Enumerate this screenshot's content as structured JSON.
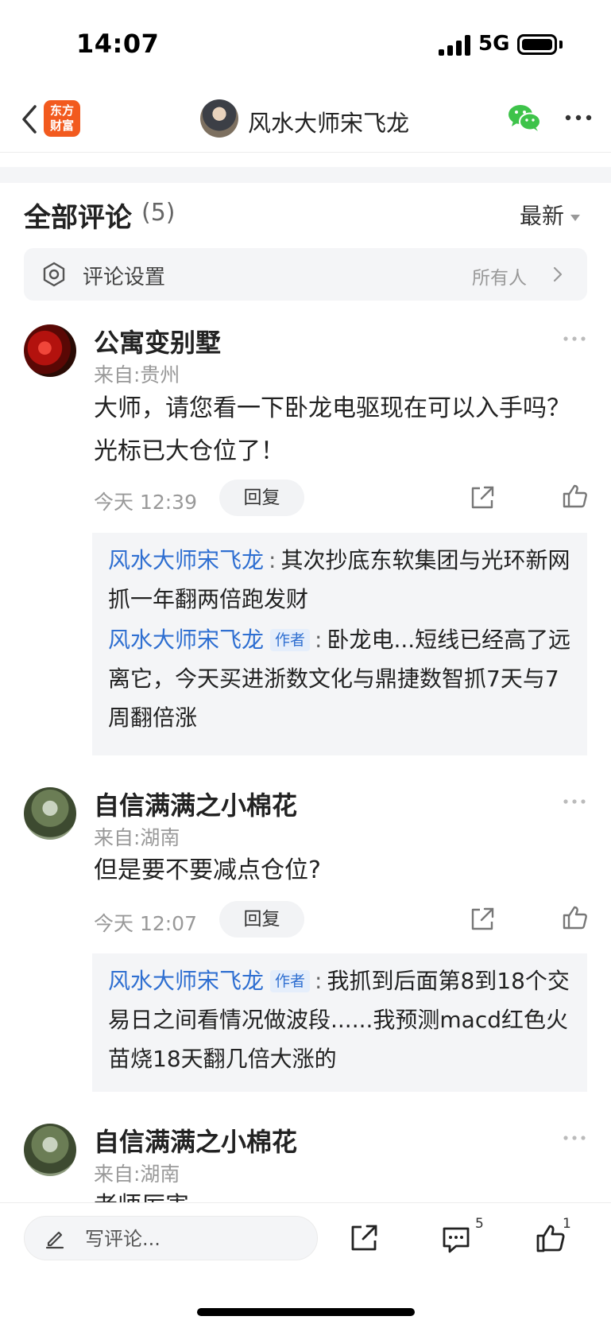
{
  "status_bar": {
    "time": "14:07",
    "network": "5G"
  },
  "nav": {
    "app_logo_line1": "东方",
    "app_logo_line2": "财富",
    "title": "风水大师宋飞龙"
  },
  "comments_header": {
    "title": "全部评论",
    "count": "(5)",
    "sort": "最新"
  },
  "settings": {
    "label": "评论设置",
    "value": "所有人"
  },
  "comments": [
    {
      "name": "公寓变别墅",
      "location": "来自:贵州",
      "text": "大师，请您看一下卧龙电驱现在可以入手吗？光标已大仓位了！",
      "time": "今天 12:39",
      "reply_label": "回复",
      "replies": [
        {
          "author": "风水大师宋飞龙",
          "tag": "",
          "colon": ":",
          "text": "其次抄底东软集团与光环新网抓一年翻两倍跑发财"
        },
        {
          "author": "风水大师宋飞龙",
          "tag": "作者",
          "colon": ":",
          "text": "卧龙电...短线已经高了远离它，今天买进浙数文化与鼎捷数智抓7天与7周翻倍涨"
        }
      ]
    },
    {
      "name": "自信满满之小棉花",
      "location": "来自:湖南",
      "text": "但是要不要减点仓位?",
      "time": "今天 12:07",
      "reply_label": "回复",
      "replies": [
        {
          "author": "风水大师宋飞龙",
          "tag": "作者",
          "colon": ":",
          "text": "我抓到后面第8到18个交易日之间看情况做波段......我预测macd红色火苗烧18天翻几倍大涨的"
        }
      ]
    },
    {
      "name": "自信满满之小棉花",
      "location": "来自:湖南",
      "text": "老师厉害"
    }
  ],
  "bottom_bar": {
    "input_placeholder": "写评论...",
    "comment_count": "5",
    "like_count": "1"
  },
  "colors": {
    "link_blue": "#2f6fd1",
    "brand_orange": "#f25a1e",
    "wechat_green": "#3ec34a"
  }
}
